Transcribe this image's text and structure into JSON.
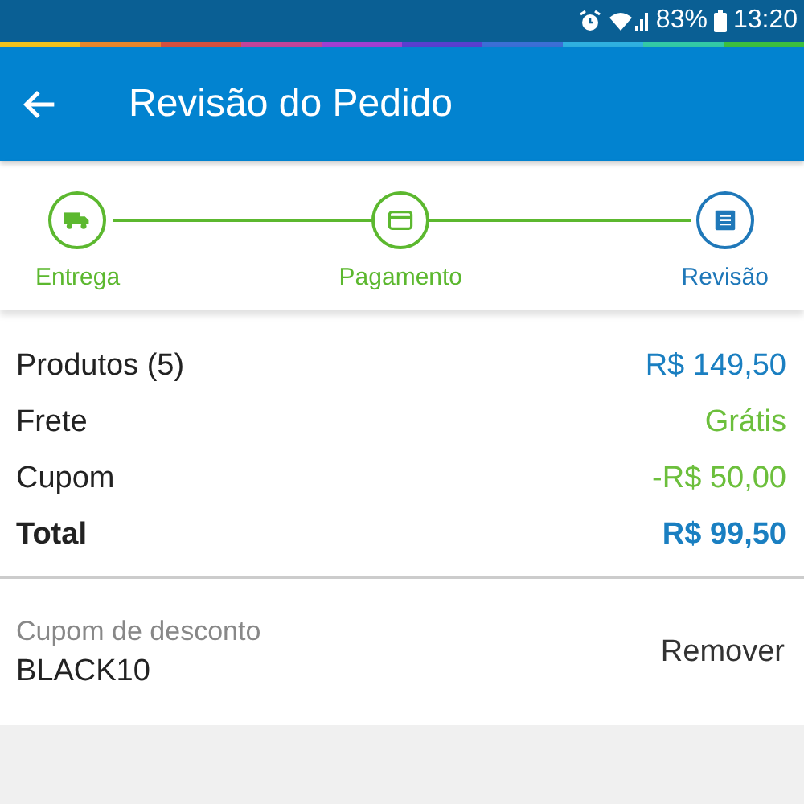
{
  "status_bar": {
    "battery": "83%",
    "time": "13:20"
  },
  "app_bar": {
    "title": "Revisão do Pedido"
  },
  "steps": [
    {
      "label": "Entrega",
      "kind": "truck",
      "selected": false
    },
    {
      "label": "Pagamento",
      "kind": "card",
      "selected": false
    },
    {
      "label": "Revisão",
      "kind": "list",
      "selected": true
    }
  ],
  "summary": [
    {
      "label": "Produtos (5)",
      "value": "R$ 149,50",
      "color": "#1a7fc1",
      "kind": "line"
    },
    {
      "label": "Frete",
      "value": "Grátis",
      "color": "#6cbf3c",
      "kind": "line"
    },
    {
      "label": "Cupom",
      "value": "-R$ 50,00",
      "color": "#6cbf3c",
      "kind": "line"
    },
    {
      "label": "Total",
      "value": "R$ 99,50",
      "color": "#1a7fc1",
      "kind": "total"
    }
  ],
  "coupon": {
    "label": "Cupom de desconto",
    "code": "BLACK10",
    "action": "Remover"
  }
}
